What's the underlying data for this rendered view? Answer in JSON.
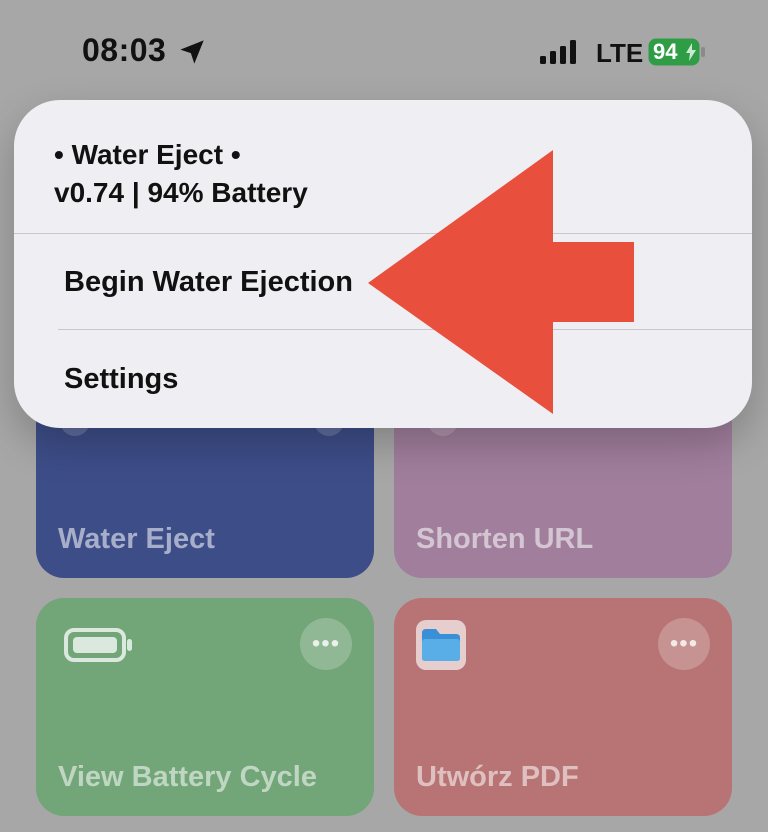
{
  "status_bar": {
    "time": "08:03",
    "network": "LTE",
    "battery_level": "94",
    "battery_color": "#2f9d46"
  },
  "menu": {
    "header_line1": "• Water Eject •",
    "header_line2": "v0.74 | 94% Battery",
    "items": [
      {
        "label": "Begin Water Ejection"
      },
      {
        "label": "Settings"
      }
    ]
  },
  "shortcuts": [
    {
      "label": "Water Eject",
      "color": "#3d4d88"
    },
    {
      "label": "Shorten URL",
      "color": "#a07e9c"
    },
    {
      "label": "View Battery Cycle",
      "color": "#72a578",
      "icon": "battery-icon"
    },
    {
      "label": "Utwórz PDF",
      "color": "#b87474",
      "icon": "folder-icon"
    }
  ],
  "annotation": {
    "arrow_color": "#e94f3d"
  }
}
